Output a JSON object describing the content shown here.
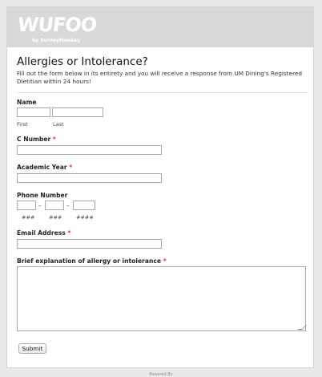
{
  "header": {
    "logo_text": "WUFOO",
    "logo_sub": "by SurveyMonkey"
  },
  "form": {
    "title": "Allergies or Intolerance?",
    "description": "Fill out the form below in its entirety and you will receive a response from UM Dining's Registered Dietitian within 24 hours!",
    "name": {
      "label": "Name",
      "first_label": "First",
      "last_label": "Last",
      "first_value": "",
      "last_value": ""
    },
    "c_number": {
      "label": "C Number",
      "required": "*",
      "value": ""
    },
    "academic_year": {
      "label": "Academic Year",
      "required": "*",
      "value": ""
    },
    "phone": {
      "label": "Phone Number",
      "area_hint": "###",
      "prefix_hint": "###",
      "line_hint": "####",
      "separator": "–"
    },
    "email": {
      "label": "Email Address",
      "required": "*",
      "value": ""
    },
    "explanation": {
      "label": "Brief explanation of allergy or intolerance",
      "required": "*",
      "value": ""
    },
    "submit_label": "Submit"
  },
  "footer": {
    "text": "Powered By"
  }
}
